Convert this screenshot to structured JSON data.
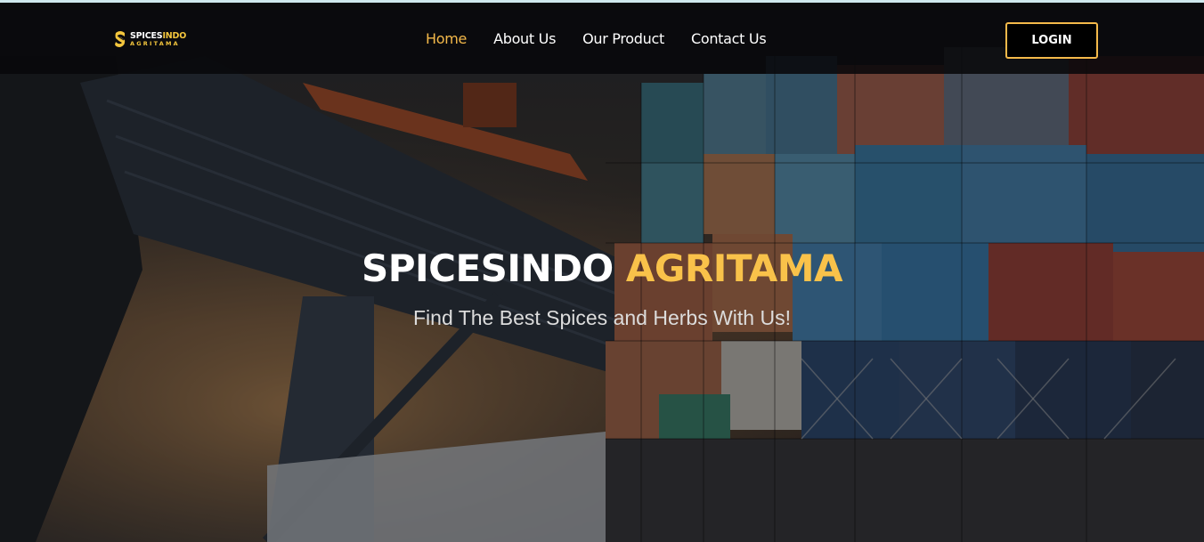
{
  "brand": {
    "line1_main": "SPICES",
    "line1_accent": "INDO",
    "line2": "AGRITAMA",
    "accent_color": "#f4c63d"
  },
  "nav": {
    "items": [
      {
        "label": "Home",
        "active": true
      },
      {
        "label": "About Us",
        "active": false
      },
      {
        "label": "Our Product",
        "active": false
      },
      {
        "label": "Contact Us",
        "active": false
      }
    ],
    "active_color": "#f4b94a",
    "login_label": "LOGIN"
  },
  "hero": {
    "title_main": "SPICESINDO",
    "title_accent": "AGRITAMA",
    "subtitle": "Find The Best Spices and Herbs With Us!",
    "background": "shipping containers at port with crane"
  },
  "icons": {
    "logo": "spices-logo-icon"
  }
}
